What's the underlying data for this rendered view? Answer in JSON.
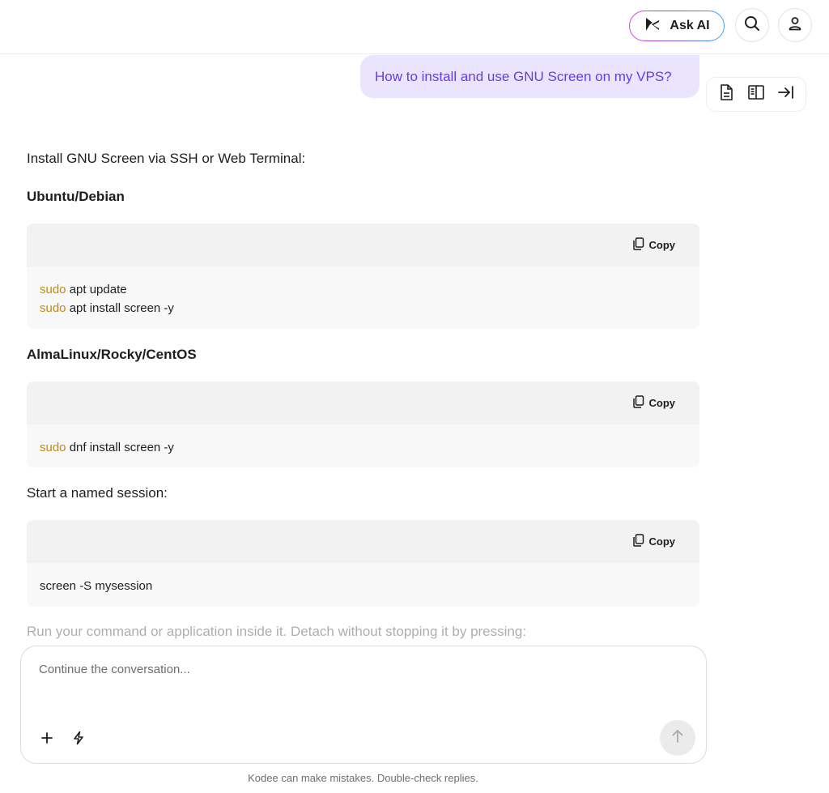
{
  "header": {
    "ask_ai_label": "Ask AI"
  },
  "conversation": {
    "user_message": "How to install and use GNU Screen on my VPS?",
    "intro": "Install GNU Screen via SSH or Web Terminal:",
    "sections": [
      {
        "heading": "Ubuntu/Debian",
        "code": [
          {
            "kw": "sudo",
            "rest": " apt update"
          },
          {
            "kw": "sudo",
            "rest": " apt install screen -y"
          }
        ]
      },
      {
        "heading": "AlmaLinux/Rocky/CentOS",
        "code": [
          {
            "kw": "sudo",
            "rest": " dnf install screen -y"
          }
        ]
      }
    ],
    "start_label": "Start a named session:",
    "start_code": "screen -S mysession",
    "faded_text": "Run your command or application inside it. Detach without stopping it by pressing:",
    "copy_label": "Copy"
  },
  "composer": {
    "placeholder": "Continue the conversation..."
  },
  "footer": {
    "disclaimer": "Kodee can make mistakes. Double-check replies."
  },
  "colors": {
    "accent": "#673de6",
    "user_bubble": "#ebe4ff",
    "keyword": "#c08a14"
  }
}
